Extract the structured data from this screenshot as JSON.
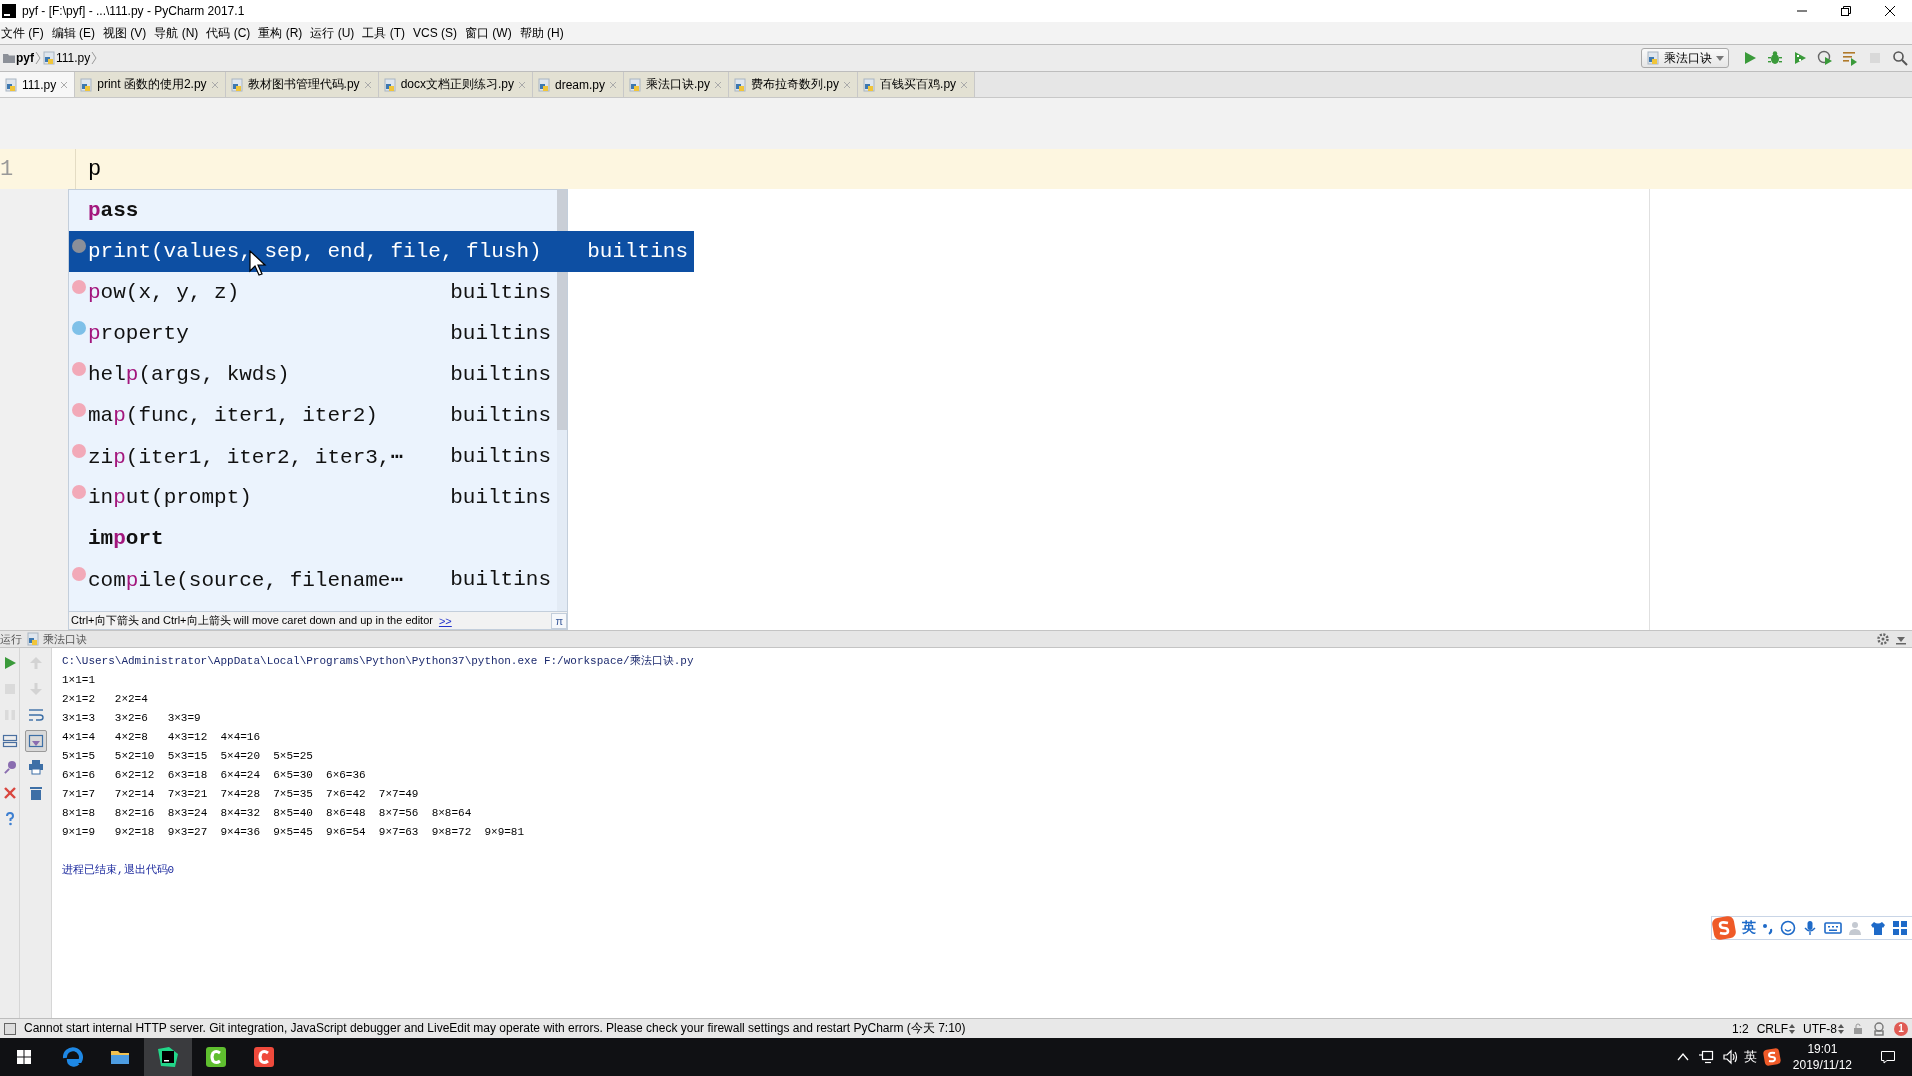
{
  "window": {
    "title": "pyf - [F:\\pyf] - ...\\111.py - PyCharm 2017.1"
  },
  "menu": [
    "文件 (F)",
    "编辑 (E)",
    "视图 (V)",
    "导航 (N)",
    "代码 (C)",
    "重构 (R)",
    "运行 (U)",
    "工具 (T)",
    "VCS (S)",
    "窗口 (W)",
    "帮助 (H)"
  ],
  "breadcrumb": [
    "pyf",
    "111.py"
  ],
  "toolbar": {
    "run_config": "乘法口诀",
    "tools": [
      {
        "kind": "run",
        "disabled": false
      },
      {
        "kind": "debug",
        "disabled": false
      },
      {
        "kind": "coverage",
        "disabled": false
      },
      {
        "kind": "profile",
        "disabled": false
      },
      {
        "kind": "concurrency",
        "disabled": false
      },
      {
        "kind": "stop",
        "disabled": true
      },
      {
        "kind": "search",
        "disabled": false
      }
    ]
  },
  "tabs": [
    {
      "label": "111.py",
      "selected": true
    },
    {
      "label": "print 函数的使用2.py",
      "selected": false
    },
    {
      "label": "教材图书管理代码.py",
      "selected": false
    },
    {
      "label": "docx文档正则练习.py",
      "selected": false
    },
    {
      "label": "dream.py",
      "selected": false
    },
    {
      "label": "乘法口诀.py",
      "selected": false
    },
    {
      "label": "费布拉奇数列.py",
      "selected": false
    },
    {
      "label": "百钱买百鸡.py",
      "selected": false
    }
  ],
  "editor": {
    "line_number": "1",
    "code": "p"
  },
  "completion": {
    "items": [
      {
        "kind": "keyword",
        "match": "p",
        "post": "ass",
        "selected": false
      },
      {
        "kind": "function",
        "match": "p",
        "post": "rint(values, sep, end, file, flush)",
        "source": "builtins",
        "selected": true
      },
      {
        "kind": "function",
        "match": "p",
        "post": "ow(x, y, z)",
        "source": "builtins",
        "selected": false
      },
      {
        "kind": "class",
        "match": "p",
        "post": "roperty",
        "source": "builtins",
        "selected": false
      },
      {
        "kind": "function",
        "pre": "hel",
        "match": "p",
        "post": "(args, kwds)",
        "source": "builtins",
        "selected": false
      },
      {
        "kind": "function",
        "pre": "ma",
        "match": "p",
        "post": "(func, iter1, iter2)",
        "source": "builtins",
        "selected": false
      },
      {
        "kind": "function",
        "pre": "zi",
        "match": "p",
        "post": "(iter1, iter2, iter3,⋯",
        "source": "builtins",
        "selected": false
      },
      {
        "kind": "function",
        "pre": "in",
        "match": "p",
        "post": "ut(prompt)",
        "source": "builtins",
        "selected": false
      },
      {
        "kind": "keyword",
        "pre": "im",
        "match": "p",
        "post": "ort",
        "selected": false
      },
      {
        "kind": "function",
        "pre": "com",
        "match": "p",
        "post": "ile(source, filename⋯",
        "source": "builtins",
        "selected": false
      }
    ],
    "hint": "Ctrl+向下箭头 and Ctrl+向上箭头 will move caret down and up in the editor",
    "hint_link": ">>",
    "pi": "π"
  },
  "run": {
    "label": "运行",
    "config": "乘法口诀",
    "left_tools": [
      {
        "kind": "run",
        "disabled": false
      },
      {
        "kind": "stop",
        "disabled": true
      },
      {
        "kind": "pause",
        "disabled": true
      },
      {
        "kind": "layout",
        "disabled": false
      },
      {
        "kind": "pin",
        "disabled": false
      },
      {
        "kind": "close",
        "disabled": false
      },
      {
        "kind": "help",
        "disabled": false
      }
    ],
    "right_tools": [
      {
        "kind": "up",
        "disabled": true,
        "pressed": false
      },
      {
        "kind": "down",
        "disabled": true,
        "pressed": false
      },
      {
        "kind": "wrap",
        "disabled": false,
        "pressed": false
      },
      {
        "kind": "scroll-end",
        "disabled": false,
        "pressed": true
      },
      {
        "kind": "print",
        "disabled": false,
        "pressed": false
      },
      {
        "kind": "trash",
        "disabled": false,
        "pressed": false
      }
    ],
    "command": "C:\\Users\\Administrator\\AppData\\Local\\Programs\\Python\\Python37\\python.exe F:/workspace/乘法口诀.py",
    "output": [
      "1×1=1",
      "2×1=2\t2×2=4",
      "3×1=3\t3×2=6\t3×3=9",
      "4×1=4\t4×2=8\t4×3=12\t4×4=16",
      "5×1=5\t5×2=10\t5×3=15\t5×4=20\t5×5=25",
      "6×1=6\t6×2=12\t6×3=18\t6×4=24\t6×5=30\t6×6=36",
      "7×1=7\t7×2=14\t7×3=21\t7×4=28\t7×5=35\t7×6=42\t7×7=49",
      "8×1=8\t8×2=16\t8×3=24\t8×4=32\t8×5=40\t8×6=48\t8×7=56\t8×8=64",
      "9×1=9\t9×2=18\t9×3=27\t9×4=36\t9×5=45\t9×6=54\t9×7=63\t9×8=72\t9×9=81"
    ],
    "exit": "进程已结束,退出代码0"
  },
  "ime": {
    "mode": "英"
  },
  "status": {
    "message": "Cannot start internal HTTP server. Git integration, JavaScript debugger and LiveEdit may operate with errors. Please check your firewall settings and restart PyCharm (今天 7:10)",
    "position": "1:2",
    "line_sep": "CRLF",
    "encoding": "UTF-8",
    "notifications": "1"
  },
  "taskbar": {
    "input": "英",
    "time": "19:01",
    "date": "2019/11/12"
  }
}
